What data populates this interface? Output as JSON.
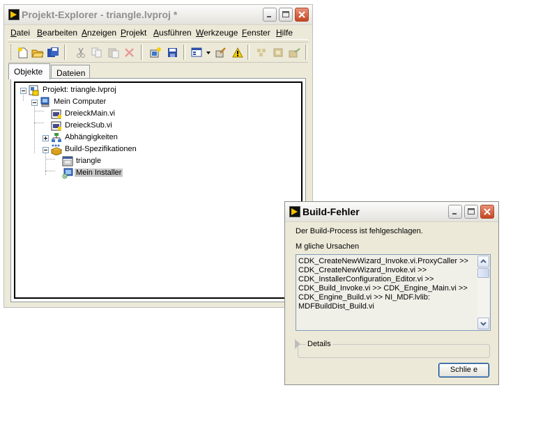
{
  "explorer": {
    "title": "Projekt-Explorer - triangle.lvproj *",
    "menu": [
      "Datei",
      "Bearbeiten",
      "Anzeigen",
      "Projekt",
      "Ausführen",
      "Werkzeuge",
      "Fenster",
      "Hilfe"
    ],
    "tabs": [
      "Objekte",
      "Dateien"
    ],
    "tree": {
      "project": "Projekt: triangle.lvproj",
      "computer": "Mein Computer",
      "vi1": "DreieckMain.vi",
      "vi2": "DreieckSub.vi",
      "deps": "Abhängigkeiten",
      "build": "Build-Spezifikationen",
      "app": "triangle",
      "installer": "Mein Installer"
    }
  },
  "dialog": {
    "title": "Build-Fehler",
    "message": "Der Build-Process ist fehlgeschlagen.",
    "causes_label": "M gliche Ursachen",
    "causes": [
      "CDK_CreateNewWizard_Invoke.vi.ProxyCaller >>",
      "CDK_CreateNewWizard_Invoke.vi >>",
      "CDK_InstallerConfiguration_Editor.vi >>",
      "CDK_Build_Invoke.vi >> CDK_Engine_Main.vi >>",
      "CDK_Engine_Build.vi >> NI_MDF.lvlib:",
      "MDFBuildDist_Build.vi"
    ],
    "details_label": "Details",
    "close_label": "Schlie e"
  }
}
